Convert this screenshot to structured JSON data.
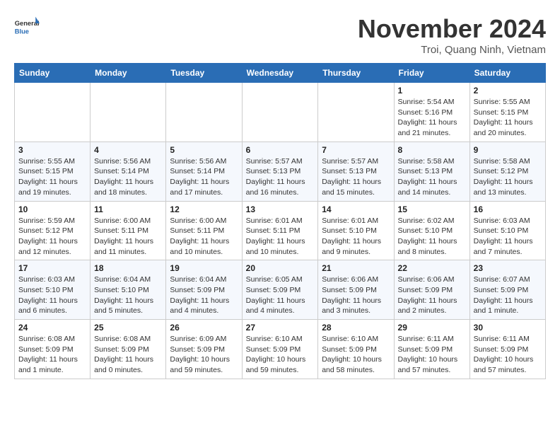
{
  "logo": {
    "general": "General",
    "blue": "Blue"
  },
  "header": {
    "title": "November 2024",
    "subtitle": "Troi, Quang Ninh, Vietnam"
  },
  "weekdays": [
    "Sunday",
    "Monday",
    "Tuesday",
    "Wednesday",
    "Thursday",
    "Friday",
    "Saturday"
  ],
  "weeks": [
    [
      {
        "day": "",
        "info": ""
      },
      {
        "day": "",
        "info": ""
      },
      {
        "day": "",
        "info": ""
      },
      {
        "day": "",
        "info": ""
      },
      {
        "day": "",
        "info": ""
      },
      {
        "day": "1",
        "info": "Sunrise: 5:54 AM\nSunset: 5:16 PM\nDaylight: 11 hours\nand 21 minutes."
      },
      {
        "day": "2",
        "info": "Sunrise: 5:55 AM\nSunset: 5:15 PM\nDaylight: 11 hours\nand 20 minutes."
      }
    ],
    [
      {
        "day": "3",
        "info": "Sunrise: 5:55 AM\nSunset: 5:15 PM\nDaylight: 11 hours\nand 19 minutes."
      },
      {
        "day": "4",
        "info": "Sunrise: 5:56 AM\nSunset: 5:14 PM\nDaylight: 11 hours\nand 18 minutes."
      },
      {
        "day": "5",
        "info": "Sunrise: 5:56 AM\nSunset: 5:14 PM\nDaylight: 11 hours\nand 17 minutes."
      },
      {
        "day": "6",
        "info": "Sunrise: 5:57 AM\nSunset: 5:13 PM\nDaylight: 11 hours\nand 16 minutes."
      },
      {
        "day": "7",
        "info": "Sunrise: 5:57 AM\nSunset: 5:13 PM\nDaylight: 11 hours\nand 15 minutes."
      },
      {
        "day": "8",
        "info": "Sunrise: 5:58 AM\nSunset: 5:13 PM\nDaylight: 11 hours\nand 14 minutes."
      },
      {
        "day": "9",
        "info": "Sunrise: 5:58 AM\nSunset: 5:12 PM\nDaylight: 11 hours\nand 13 minutes."
      }
    ],
    [
      {
        "day": "10",
        "info": "Sunrise: 5:59 AM\nSunset: 5:12 PM\nDaylight: 11 hours\nand 12 minutes."
      },
      {
        "day": "11",
        "info": "Sunrise: 6:00 AM\nSunset: 5:11 PM\nDaylight: 11 hours\nand 11 minutes."
      },
      {
        "day": "12",
        "info": "Sunrise: 6:00 AM\nSunset: 5:11 PM\nDaylight: 11 hours\nand 10 minutes."
      },
      {
        "day": "13",
        "info": "Sunrise: 6:01 AM\nSunset: 5:11 PM\nDaylight: 11 hours\nand 10 minutes."
      },
      {
        "day": "14",
        "info": "Sunrise: 6:01 AM\nSunset: 5:10 PM\nDaylight: 11 hours\nand 9 minutes."
      },
      {
        "day": "15",
        "info": "Sunrise: 6:02 AM\nSunset: 5:10 PM\nDaylight: 11 hours\nand 8 minutes."
      },
      {
        "day": "16",
        "info": "Sunrise: 6:03 AM\nSunset: 5:10 PM\nDaylight: 11 hours\nand 7 minutes."
      }
    ],
    [
      {
        "day": "17",
        "info": "Sunrise: 6:03 AM\nSunset: 5:10 PM\nDaylight: 11 hours\nand 6 minutes."
      },
      {
        "day": "18",
        "info": "Sunrise: 6:04 AM\nSunset: 5:10 PM\nDaylight: 11 hours\nand 5 minutes."
      },
      {
        "day": "19",
        "info": "Sunrise: 6:04 AM\nSunset: 5:09 PM\nDaylight: 11 hours\nand 4 minutes."
      },
      {
        "day": "20",
        "info": "Sunrise: 6:05 AM\nSunset: 5:09 PM\nDaylight: 11 hours\nand 4 minutes."
      },
      {
        "day": "21",
        "info": "Sunrise: 6:06 AM\nSunset: 5:09 PM\nDaylight: 11 hours\nand 3 minutes."
      },
      {
        "day": "22",
        "info": "Sunrise: 6:06 AM\nSunset: 5:09 PM\nDaylight: 11 hours\nand 2 minutes."
      },
      {
        "day": "23",
        "info": "Sunrise: 6:07 AM\nSunset: 5:09 PM\nDaylight: 11 hours\nand 1 minute."
      }
    ],
    [
      {
        "day": "24",
        "info": "Sunrise: 6:08 AM\nSunset: 5:09 PM\nDaylight: 11 hours\nand 1 minute."
      },
      {
        "day": "25",
        "info": "Sunrise: 6:08 AM\nSunset: 5:09 PM\nDaylight: 11 hours\nand 0 minutes."
      },
      {
        "day": "26",
        "info": "Sunrise: 6:09 AM\nSunset: 5:09 PM\nDaylight: 10 hours\nand 59 minutes."
      },
      {
        "day": "27",
        "info": "Sunrise: 6:10 AM\nSunset: 5:09 PM\nDaylight: 10 hours\nand 59 minutes."
      },
      {
        "day": "28",
        "info": "Sunrise: 6:10 AM\nSunset: 5:09 PM\nDaylight: 10 hours\nand 58 minutes."
      },
      {
        "day": "29",
        "info": "Sunrise: 6:11 AM\nSunset: 5:09 PM\nDaylight: 10 hours\nand 57 minutes."
      },
      {
        "day": "30",
        "info": "Sunrise: 6:11 AM\nSunset: 5:09 PM\nDaylight: 10 hours\nand 57 minutes."
      }
    ]
  ]
}
